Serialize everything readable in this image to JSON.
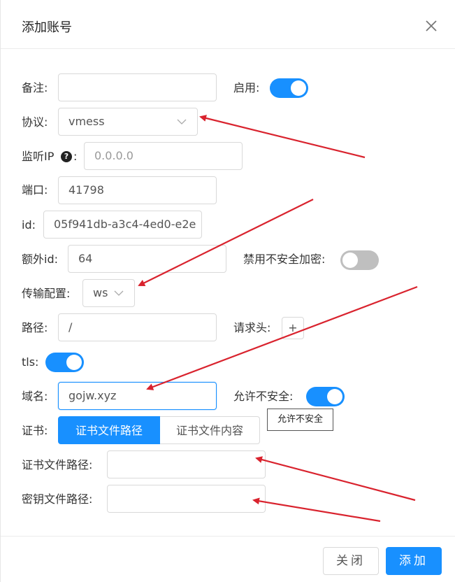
{
  "dialog": {
    "title": "添加账号"
  },
  "form": {
    "remark_label": "备注:",
    "remark_value": "",
    "enable_label": "启用:",
    "enable_on": true,
    "protocol_label": "协议:",
    "protocol_value": "vmess",
    "listen_ip_label": "监听IP",
    "listen_ip_colon": ":",
    "listen_ip_placeholder": "0.0.0.0",
    "port_label": "端口:",
    "port_value": "41798",
    "id_label": "id:",
    "id_value": "05f941db-a3c4-4ed0-e2e",
    "extra_id_label": "额外id:",
    "extra_id_value": "64",
    "disable_insecure_label": "禁用不安全加密:",
    "disable_insecure_on": false,
    "transport_label": "传输配置:",
    "transport_value": "ws",
    "path_label": "路径:",
    "path_value": "/",
    "headers_label": "请求头:",
    "headers_add": "+",
    "tls_label": "tls:",
    "tls_on": true,
    "domain_label": "域名:",
    "domain_value": "gojw.xyz",
    "allow_insecure_label": "允许不安全:",
    "allow_insecure_on": true,
    "allow_insecure_tooltip": "允许不安全",
    "cert_label": "证书:",
    "cert_tabs": [
      "证书文件路径",
      "证书文件内容"
    ],
    "cert_file_path_label": "证书文件路径:",
    "cert_file_path_value": "",
    "key_file_path_label": "密钥文件路径:",
    "key_file_path_value": ""
  },
  "footer": {
    "close_label": "关闭",
    "add_label": "添加"
  },
  "colors": {
    "primary": "#1890ff",
    "annotation_arrow": "#d9232e"
  },
  "icons": {
    "close": "close-icon",
    "select_arrow": "chevron-down-icon",
    "help": "question-circle-icon"
  }
}
